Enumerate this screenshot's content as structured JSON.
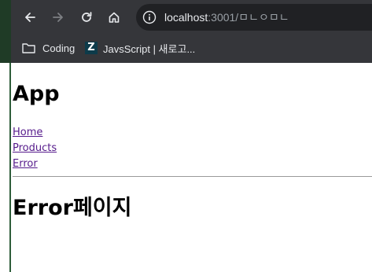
{
  "browser": {
    "url_host": "localhost",
    "url_rest": ":3001/ㅁㄴㅇㅁㄴ",
    "bookmarks": [
      {
        "label": "Coding",
        "icon": "folder-icon"
      },
      {
        "label": "JavsScript | 새로고...",
        "icon": "z-icon",
        "icon_letter": "Z"
      }
    ]
  },
  "page": {
    "title": "App",
    "nav_links": [
      "Home",
      "Products",
      "Error"
    ],
    "heading": "Error페이지"
  },
  "colors": {
    "chrome_bg": "#35363a",
    "omnibox_bg": "#202124",
    "visited_link": "#551a8b",
    "window_edge": "#2e5d3a"
  }
}
